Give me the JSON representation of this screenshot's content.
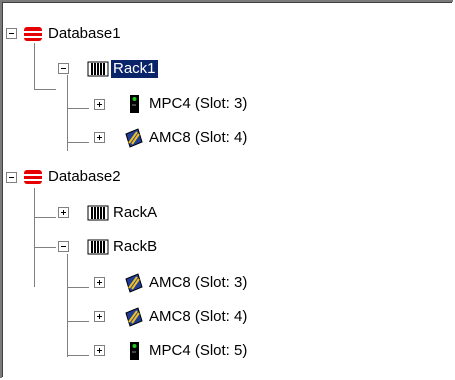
{
  "tree": [
    {
      "label": "Database1",
      "icon": "database-icon",
      "expanded": true,
      "children": [
        {
          "label": "Rack1",
          "icon": "rack-icon",
          "expanded": true,
          "selected": true,
          "children": [
            {
              "label": "MPC4 (Slot:  3)",
              "icon": "mpc-module-icon",
              "expanded": false
            },
            {
              "label": "AMC8 (Slot:  4)",
              "icon": "amc-card-icon",
              "expanded": false
            }
          ]
        }
      ]
    },
    {
      "label": "Database2",
      "icon": "database-icon",
      "expanded": true,
      "children": [
        {
          "label": "RackA",
          "icon": "rack-icon",
          "expanded": false
        },
        {
          "label": "RackB",
          "icon": "rack-icon",
          "expanded": true,
          "children": [
            {
              "label": "AMC8 (Slot:  3)",
              "icon": "amc-card-icon",
              "expanded": false
            },
            {
              "label": "AMC8 (Slot:  4)",
              "icon": "amc-card-icon",
              "expanded": false
            },
            {
              "label": "MPC4 (Slot:  5)",
              "icon": "mpc-module-icon",
              "expanded": false
            }
          ]
        }
      ]
    }
  ],
  "colors": {
    "database": "#e60000",
    "selection": "#0a246a",
    "led": "#22c922"
  }
}
